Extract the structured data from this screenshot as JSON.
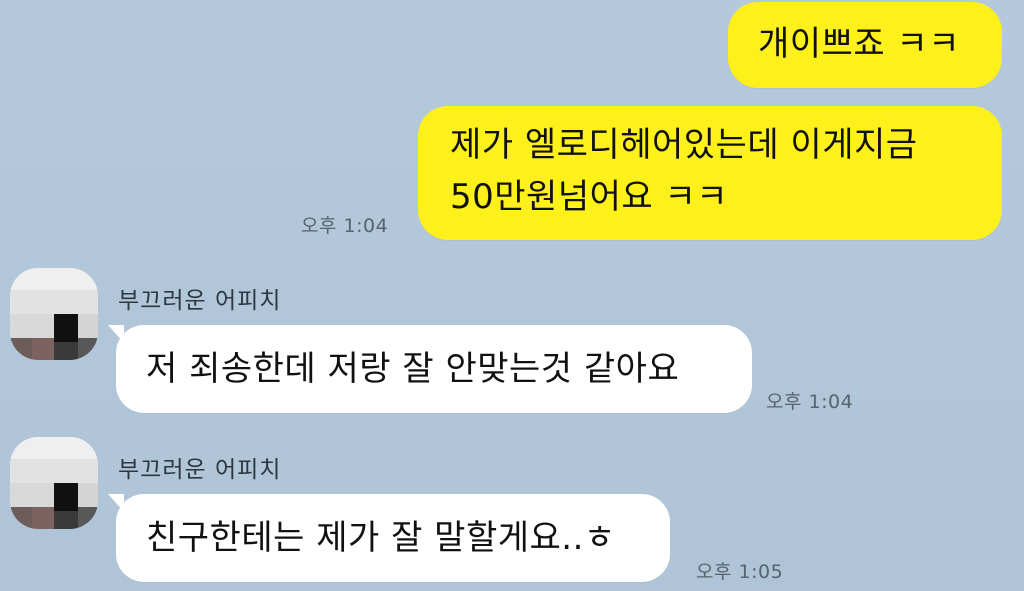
{
  "messages": [
    {
      "from": "me",
      "lines": [
        "개이쁘죠 ㅋㅋ"
      ]
    },
    {
      "from": "me",
      "lines": [
        "제가 엘로디헤어있는데 이게지금",
        "50만원넘어요 ㅋㅋ"
      ],
      "time": "오후 1:04"
    },
    {
      "from": "other",
      "sender": "부끄러운 어피치",
      "lines": [
        "저 죄송한데 저랑 잘 안맞는것 같아요"
      ],
      "time": "오후 1:04"
    },
    {
      "from": "other",
      "sender": "부끄러운 어피치",
      "lines": [
        "친구한테는 제가 잘 말할게요..ㅎ"
      ],
      "time": "오후 1:05"
    }
  ],
  "colors": {
    "background": "#b2c7d9",
    "my_bubble": "#fef01b",
    "their_bubble": "#ffffff"
  }
}
